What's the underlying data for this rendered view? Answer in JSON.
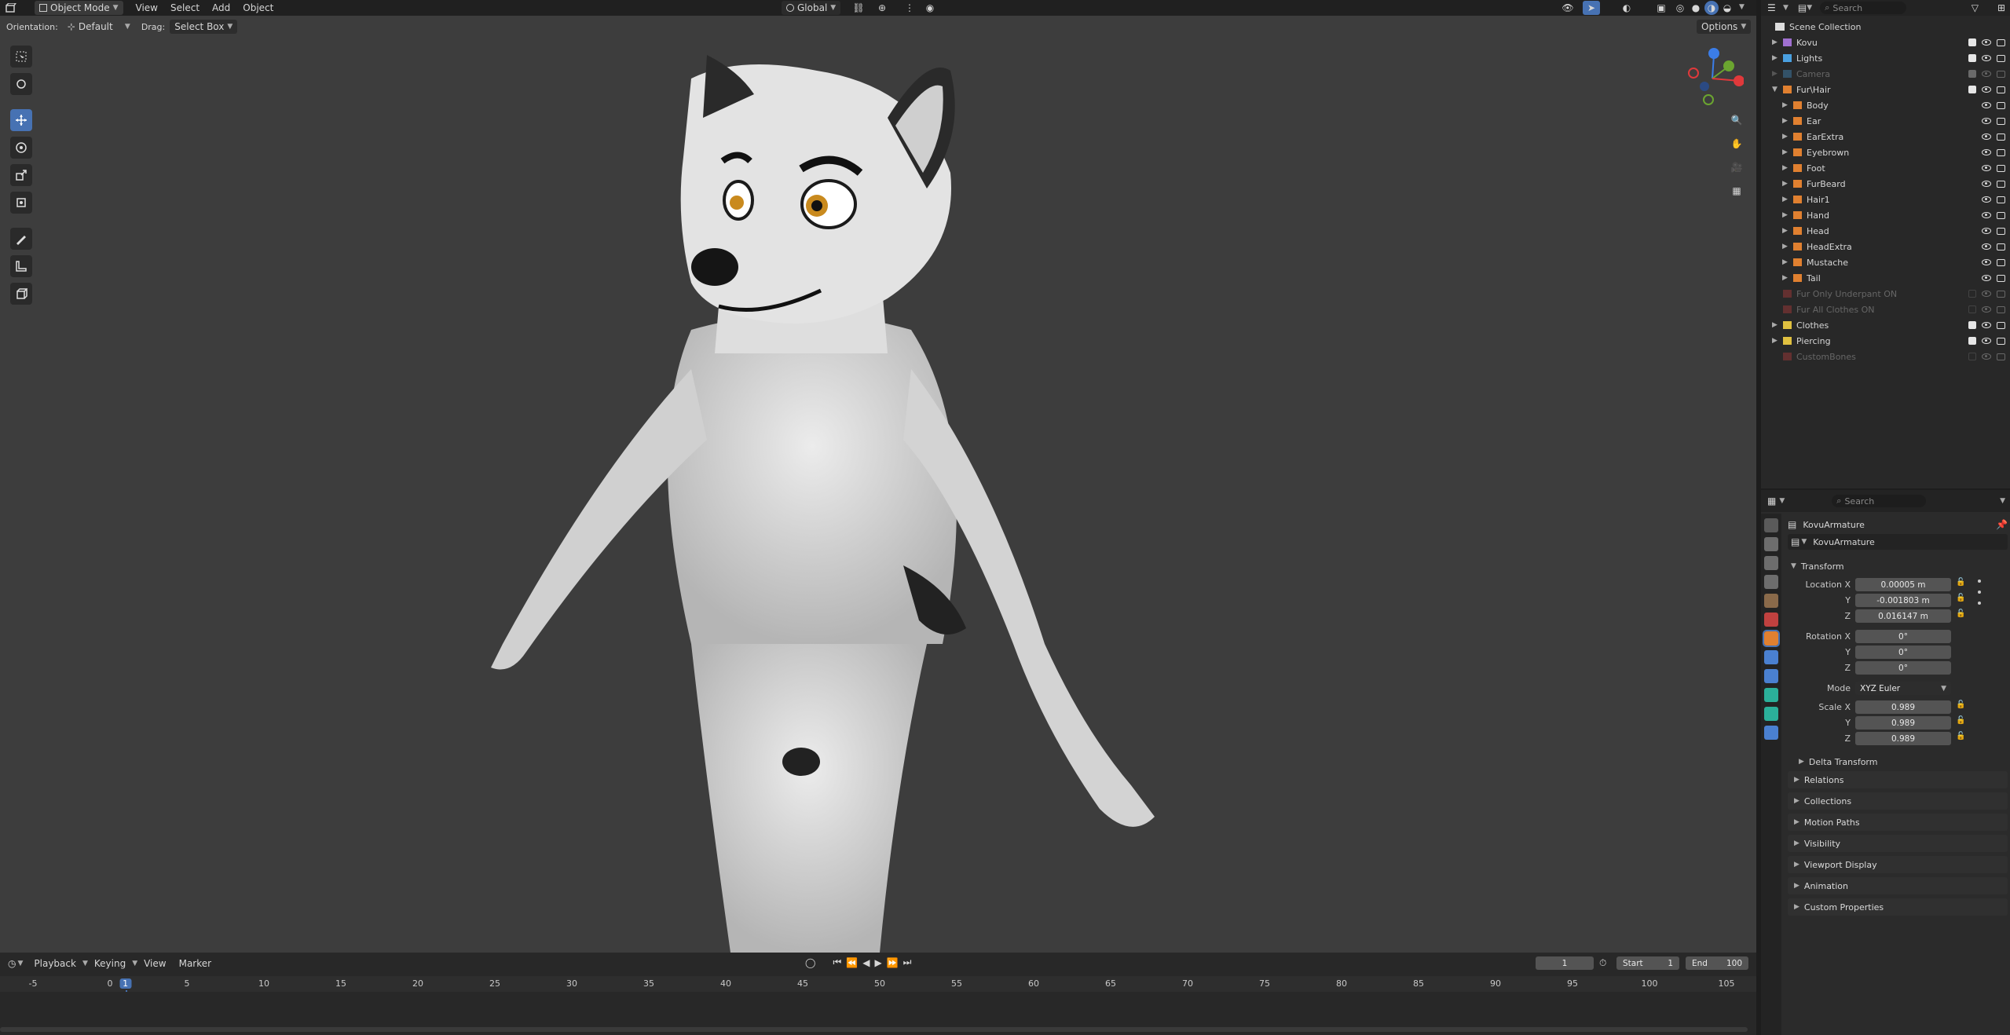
{
  "header": {
    "editor_icon": "3d-viewport-icon",
    "mode": "Object Mode",
    "menus": [
      "View",
      "Select",
      "Add",
      "Object"
    ],
    "transform_orientation": "Global",
    "orientation_label": "Orientation:",
    "orientation_value": "Default",
    "drag_label": "Drag:",
    "drag_value": "Select Box",
    "options_label": "Options"
  },
  "outliner": {
    "search_placeholder": "Search",
    "root": "Scene Collection",
    "items": [
      {
        "label": "Kovu",
        "indent": 0,
        "color": "#a070d0",
        "checked": true,
        "dim": false
      },
      {
        "label": "Lights",
        "indent": 0,
        "color": "#4aa0e0",
        "checked": true,
        "dim": false
      },
      {
        "label": "Camera",
        "indent": 0,
        "color": "#4aa0e0",
        "checked": true,
        "dim": true
      },
      {
        "label": "Fur\\Hair",
        "indent": 0,
        "color": "#e08030",
        "checked": true,
        "dim": false
      },
      {
        "label": "Body",
        "indent": 1,
        "color": "#e08030",
        "checked": null,
        "dim": false
      },
      {
        "label": "Ear",
        "indent": 1,
        "color": "#e08030",
        "checked": null,
        "dim": false
      },
      {
        "label": "EarExtra",
        "indent": 1,
        "color": "#e08030",
        "checked": null,
        "dim": false
      },
      {
        "label": "Eyebrown",
        "indent": 1,
        "color": "#e08030",
        "checked": null,
        "dim": false
      },
      {
        "label": "Foot",
        "indent": 1,
        "color": "#e08030",
        "checked": null,
        "dim": false
      },
      {
        "label": "FurBeard",
        "indent": 1,
        "color": "#e08030",
        "checked": null,
        "dim": false
      },
      {
        "label": "Hair1",
        "indent": 1,
        "color": "#e08030",
        "checked": null,
        "dim": false
      },
      {
        "label": "Hand",
        "indent": 1,
        "color": "#e08030",
        "checked": null,
        "dim": false
      },
      {
        "label": "Head",
        "indent": 1,
        "color": "#e08030",
        "checked": null,
        "dim": false
      },
      {
        "label": "HeadExtra",
        "indent": 1,
        "color": "#e08030",
        "checked": null,
        "dim": false
      },
      {
        "label": "Mustache",
        "indent": 1,
        "color": "#e08030",
        "checked": null,
        "dim": false
      },
      {
        "label": "Tail",
        "indent": 1,
        "color": "#e08030",
        "checked": null,
        "dim": false
      },
      {
        "label": "Fur Only Underpant ON",
        "indent": 0,
        "color": "#d04040",
        "checked": false,
        "dim": true
      },
      {
        "label": "Fur All Clothes ON",
        "indent": 0,
        "color": "#d04040",
        "checked": false,
        "dim": true
      },
      {
        "label": "Clothes",
        "indent": 0,
        "color": "#e0c040",
        "checked": true,
        "dim": false
      },
      {
        "label": "Piercing",
        "indent": 0,
        "color": "#e0c040",
        "checked": true,
        "dim": false
      },
      {
        "label": "CustomBones",
        "indent": 0,
        "color": "#d04040",
        "checked": false,
        "dim": true
      }
    ]
  },
  "properties": {
    "search_placeholder": "Search",
    "object_name": "KovuArmature",
    "data_name": "KovuArmature",
    "transform_label": "Transform",
    "location_label": "Location X",
    "location": [
      "0.00005 m",
      "-0.001803 m",
      "0.016147 m"
    ],
    "rotation_label": "Rotation X",
    "rotation": [
      "0°",
      "0°",
      "0°"
    ],
    "mode_label": "Mode",
    "mode_value": "XYZ Euler",
    "scale_label": "Scale X",
    "scale": [
      "0.989",
      "0.989",
      "0.989"
    ],
    "y_label": "Y",
    "z_label": "Z",
    "delta_transform": "Delta Transform",
    "sections": [
      "Relations",
      "Collections",
      "Motion Paths",
      "Visibility",
      "Viewport Display",
      "Animation",
      "Custom Properties"
    ]
  },
  "timeline": {
    "menus": [
      "Playback",
      "Keying",
      "View",
      "Marker"
    ],
    "current_frame": "1",
    "start_label": "Start",
    "start": "1",
    "end_label": "End",
    "end": "100",
    "ticks": [
      "-5",
      "0",
      "1",
      "5",
      "10",
      "15",
      "20",
      "25",
      "30",
      "35",
      "40",
      "45",
      "50",
      "55",
      "60",
      "65",
      "70",
      "75",
      "80",
      "85",
      "90",
      "95",
      "100",
      "105"
    ]
  },
  "colors": {
    "accent": "#4772b3",
    "viewport_bg": "#3d3d3d",
    "gizmo_x": "#e0393b",
    "gizmo_y": "#6ba530",
    "gizmo_z": "#3b7de8"
  }
}
